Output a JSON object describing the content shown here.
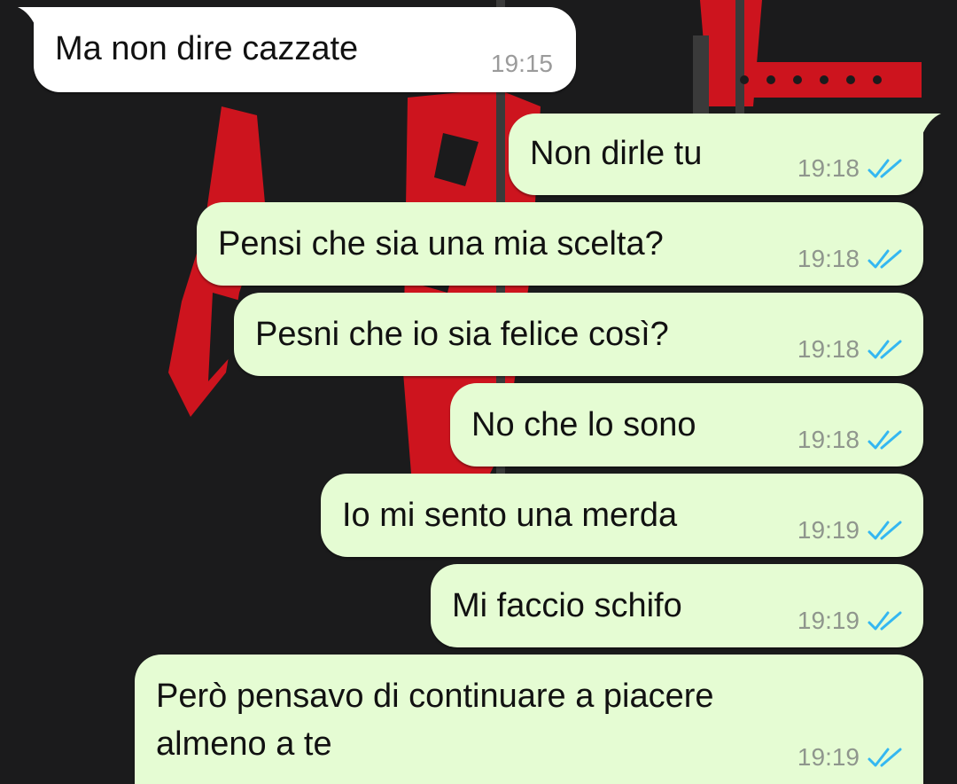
{
  "colors": {
    "outgoing_bubble": "#e5fcd3",
    "incoming_bubble": "#ffffff",
    "read_tick": "#34b7f1",
    "wallpaper_bg": "#1b1b1c",
    "wallpaper_accent": "#d7141f"
  },
  "messages": [
    {
      "direction": "incoming",
      "text": "Ma non dire cazzate",
      "time": "19:15"
    },
    {
      "direction": "outgoing",
      "text": "Non dirle tu",
      "time": "19:18",
      "status": "read-double-tick-icon"
    },
    {
      "direction": "outgoing",
      "text": "Pensi che sia una mia scelta?",
      "time": "19:18",
      "status": "read-double-tick-icon"
    },
    {
      "direction": "outgoing",
      "text": "Pesni che io sia felice così?",
      "time": "19:18",
      "status": "read-double-tick-icon"
    },
    {
      "direction": "outgoing",
      "text": "No che lo sono",
      "time": "19:18",
      "status": "read-double-tick-icon"
    },
    {
      "direction": "outgoing",
      "text": "Io mi sento una merda",
      "time": "19:19",
      "status": "read-double-tick-icon"
    },
    {
      "direction": "outgoing",
      "text": "Mi faccio schifo",
      "time": "19:19",
      "status": "read-double-tick-icon"
    },
    {
      "direction": "outgoing",
      "text": "Però pensavo di continuare a piacere\nalmeno a te",
      "time": "19:19",
      "status": "read-double-tick-icon"
    }
  ]
}
